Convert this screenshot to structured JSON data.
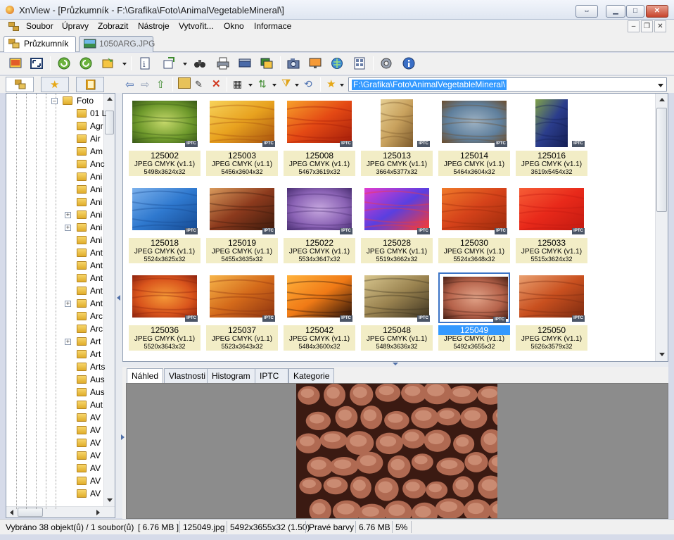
{
  "window": {
    "title": "XnView - [Průzkumník - F:\\Grafika\\Foto\\AnimalVegetableMineral\\]"
  },
  "menu": {
    "items": [
      "Soubor",
      "Úpravy",
      "Zobrazit",
      "Nástroje",
      "Vytvořit...",
      "Okno",
      "Informace"
    ]
  },
  "doc_tabs": [
    {
      "label": "Průzkumník",
      "active": true
    },
    {
      "label": "1050ARG.JPG",
      "active": false
    }
  ],
  "toolbar": {
    "icons": [
      "browser-icon",
      "fullscreen-icon",
      "refresh-icon",
      "rotate-icon",
      "slideshow-icon",
      "properties-icon",
      "convert-icon",
      "find-icon",
      "print-icon",
      "scanner-icon",
      "batch-icon",
      "capture-icon",
      "screensaver-icon",
      "web-icon",
      "contact-sheet-icon",
      "settings-icon",
      "info-icon"
    ]
  },
  "address_bar": {
    "path": "F:\\Grafika\\Foto\\AnimalVegetableMineral\\"
  },
  "tree": {
    "root": "Foto",
    "items": [
      "01 L",
      "Agr",
      "Air",
      "Am",
      "Anc",
      "Ani",
      "Ani",
      "Ani",
      "Ani",
      "Ani",
      "Ani",
      "Ant",
      "Ant",
      "Ant",
      "Ant",
      "Ant",
      "Arc",
      "Arc",
      "Art",
      "Art",
      "Arts",
      "Aus",
      "Aus",
      "Aut",
      "AV",
      "AV",
      "AV",
      "AV",
      "AV",
      "AV",
      "AV"
    ],
    "expandable_rows": [
      9,
      10,
      16,
      19
    ]
  },
  "thumbnails": [
    {
      "name": "125002",
      "type": "JPEG CMYK (v1.1)",
      "dims": "5498x3624x32",
      "badge": "IPTC",
      "colors": [
        "#6f9a2c",
        "#c5d86a",
        "#3a5a18"
      ],
      "orientation": "landscape"
    },
    {
      "name": "125003",
      "type": "JPEG CMYK (v1.1)",
      "dims": "5456x3604x32",
      "badge": "IPTC",
      "colors": [
        "#e8a21f",
        "#f7d25a",
        "#a8520d"
      ],
      "orientation": "landscape"
    },
    {
      "name": "125008",
      "type": "JPEG CMYK (v1.1)",
      "dims": "5467x3619x32",
      "badge": "IPTC",
      "colors": [
        "#e44914",
        "#f7a02b",
        "#a31d0a"
      ],
      "orientation": "landscape"
    },
    {
      "name": "125013",
      "type": "JPEG CMYK (v1.1)",
      "dims": "3664x5377x32",
      "badge": "IPTC",
      "colors": [
        "#c9a25e",
        "#e6cf93",
        "#7c5a2c"
      ],
      "orientation": "portrait"
    },
    {
      "name": "125014",
      "type": "JPEG CMYK (v1.1)",
      "dims": "5464x3604x32",
      "badge": "IPTC",
      "colors": [
        "#5f7f9c",
        "#9db2c4",
        "#6b4e2f"
      ],
      "orientation": "landscape"
    },
    {
      "name": "125016",
      "type": "JPEG CMYK (v1.1)",
      "dims": "3619x5454x32",
      "badge": "IPTC",
      "colors": [
        "#2b3d8c",
        "#7fa14a",
        "#151f55"
      ],
      "orientation": "portrait"
    },
    {
      "name": "125018",
      "type": "JPEG CMYK (v1.1)",
      "dims": "5524x3625x32",
      "badge": "IPTC",
      "colors": [
        "#2f79cf",
        "#7cb1ec",
        "#164a92"
      ],
      "orientation": "landscape"
    },
    {
      "name": "125019",
      "type": "JPEG CMYK (v1.1)",
      "dims": "5455x3635x32",
      "badge": "IPTC",
      "colors": [
        "#8c3a1d",
        "#d99a5c",
        "#3d1a0c"
      ],
      "orientation": "landscape"
    },
    {
      "name": "125022",
      "type": "JPEG CMYK (v1.1)",
      "dims": "5534x3647x32",
      "badge": "IPTC",
      "colors": [
        "#8b63b5",
        "#c6a7df",
        "#4a2f73"
      ],
      "orientation": "landscape"
    },
    {
      "name": "125028",
      "type": "JPEG CMYK (v1.1)",
      "dims": "5519x3662x32",
      "badge": "IPTC",
      "colors": [
        "#5a3fe0",
        "#e13ccf",
        "#ff3a2c"
      ],
      "orientation": "landscape"
    },
    {
      "name": "125030",
      "type": "JPEG CMYK (v1.1)",
      "dims": "5524x3648x32",
      "badge": "IPTC",
      "colors": [
        "#d5421a",
        "#f07a2a",
        "#9b2a0c"
      ],
      "orientation": "landscape"
    },
    {
      "name": "125033",
      "type": "JPEG CMYK (v1.1)",
      "dims": "5515x3624x32",
      "badge": "IPTC",
      "colors": [
        "#e8291a",
        "#f65d36",
        "#c21a10"
      ],
      "orientation": "landscape"
    },
    {
      "name": "125036",
      "type": "JPEG CMYK (v1.1)",
      "dims": "5520x3643x32",
      "badge": "IPTC",
      "colors": [
        "#d9541c",
        "#f59a37",
        "#8f240e"
      ],
      "orientation": "landscape"
    },
    {
      "name": "125037",
      "type": "JPEG CMYK (v1.1)",
      "dims": "5523x3643x32",
      "badge": "IPTC",
      "colors": [
        "#d46a1a",
        "#f7b54a",
        "#8c3310"
      ],
      "orientation": "landscape"
    },
    {
      "name": "125042",
      "type": "JPEG CMYK (v1.1)",
      "dims": "5484x3600x32",
      "badge": "IPTC",
      "colors": [
        "#f07a16",
        "#ffb23c",
        "#2a1208"
      ],
      "orientation": "landscape"
    },
    {
      "name": "125048",
      "type": "JPEG CMYK (v1.1)",
      "dims": "5489x3636x32",
      "badge": "IPTC",
      "colors": [
        "#9a8350",
        "#d8c68e",
        "#3d3320"
      ],
      "orientation": "landscape"
    },
    {
      "name": "125049",
      "type": "JPEG CMYK (v1.1)",
      "dims": "5492x3655x32",
      "badge": "IPTC",
      "colors": [
        "#b5624a",
        "#e1a287",
        "#4a2116"
      ],
      "orientation": "landscape",
      "selected": true
    },
    {
      "name": "125050",
      "type": "JPEG CMYK (v1.1)",
      "dims": "5626x3579x32",
      "badge": "IPTC",
      "colors": [
        "#c9501f",
        "#e9a070",
        "#7b2a10"
      ],
      "orientation": "landscape"
    }
  ],
  "preview_tabs": [
    {
      "label": "Náhled",
      "active": true
    },
    {
      "label": "Vlastnosti",
      "active": false
    },
    {
      "label": "Histogram",
      "active": false
    },
    {
      "label": "IPTC",
      "active": false
    },
    {
      "label": "Kategorie",
      "active": false
    }
  ],
  "preview": {
    "colors": [
      "#b06a52",
      "#e0a58c",
      "#3b1a12"
    ]
  },
  "status": {
    "selection": "Vybráno 38 objekt(ů) / 1 soubor(ů)",
    "size": "[ 6.76 MB ]",
    "filename": "125049.jpg",
    "dimensions": "5492x3655x32 (1.50)",
    "color_mode": "Pravé barvy",
    "file_size": "6.76 MB",
    "zoom": "5%"
  }
}
